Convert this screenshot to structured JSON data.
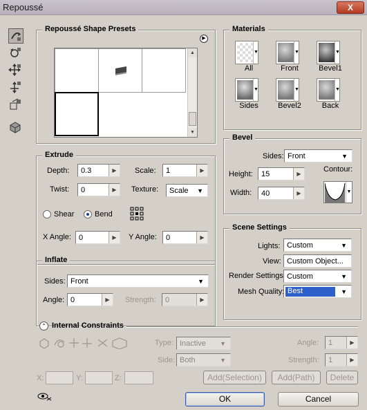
{
  "window": {
    "title": "Repoussé",
    "close_label": "X"
  },
  "tools": [
    {
      "name": "rotate-object-tool-icon"
    },
    {
      "name": "roll-object-tool-icon"
    },
    {
      "name": "drag-object-tool-icon"
    },
    {
      "name": "slide-object-tool-icon"
    },
    {
      "name": "scale-object-tool-icon"
    },
    {
      "name": "camera-view-icon"
    }
  ],
  "presets": {
    "title": "Repoussé Shape Presets",
    "menu_icon": "play-circle-icon",
    "items": [
      {
        "label": "preset-1"
      },
      {
        "label": "preset-2"
      },
      {
        "label": "preset-3"
      },
      {
        "label": "preset-4"
      }
    ]
  },
  "materials": {
    "title": "Materials",
    "items": [
      {
        "label": "All",
        "swatch": "checker"
      },
      {
        "label": "Front",
        "swatch": "grey-checker"
      },
      {
        "label": "Bevel1",
        "swatch": "sphere"
      },
      {
        "label": "Sides",
        "swatch": "sphere-light"
      },
      {
        "label": "Bevel2",
        "swatch": "grey-checker"
      },
      {
        "label": "Back",
        "swatch": "grey-checker"
      }
    ]
  },
  "extrude": {
    "title": "Extrude",
    "depth_label": "Depth:",
    "depth": "0.3",
    "scale_label": "Scale:",
    "scale": "1",
    "twist_label": "Twist:",
    "twist": "0",
    "texture_label": "Texture:",
    "texture": "Scale",
    "shear_label": "Shear",
    "bend_label": "Bend",
    "bend_selected": true,
    "xangle_label": "X Angle:",
    "xangle": "0",
    "yangle_label": "Y Angle:",
    "yangle": "0"
  },
  "bevel": {
    "title": "Bevel",
    "sides_label": "Sides:",
    "sides": "Front",
    "height_label": "Height:",
    "height": "15",
    "width_label": "Width:",
    "width": "40",
    "contour_label": "Contour:"
  },
  "inflate": {
    "title": "Inflate",
    "sides_label": "Sides:",
    "sides": "Front",
    "angle_label": "Angle:",
    "angle": "0",
    "strength_label": "Strength:",
    "strength": "0"
  },
  "scene": {
    "title": "Scene Settings",
    "lights_label": "Lights:",
    "lights": "Custom",
    "view_label": "View:",
    "view": "Custom Object...",
    "render_label": "Render Settings:",
    "render": "Custom",
    "mesh_label": "Mesh Quality:",
    "mesh": "Best"
  },
  "constraints": {
    "title": "Internal Constraints",
    "type_label": "Type:",
    "type": "Inactive",
    "side_label": "Side:",
    "side": "Both",
    "angle_label": "Angle:",
    "angle": "1",
    "strength_label": "Strength:",
    "strength": "1",
    "x_label": "X:",
    "y_label": "Y:",
    "z_label": "Z:",
    "add_selection": "Add(Selection)",
    "add_path": "Add(Path)",
    "delete": "Delete"
  },
  "buttons": {
    "ok": "OK",
    "cancel": "Cancel"
  }
}
